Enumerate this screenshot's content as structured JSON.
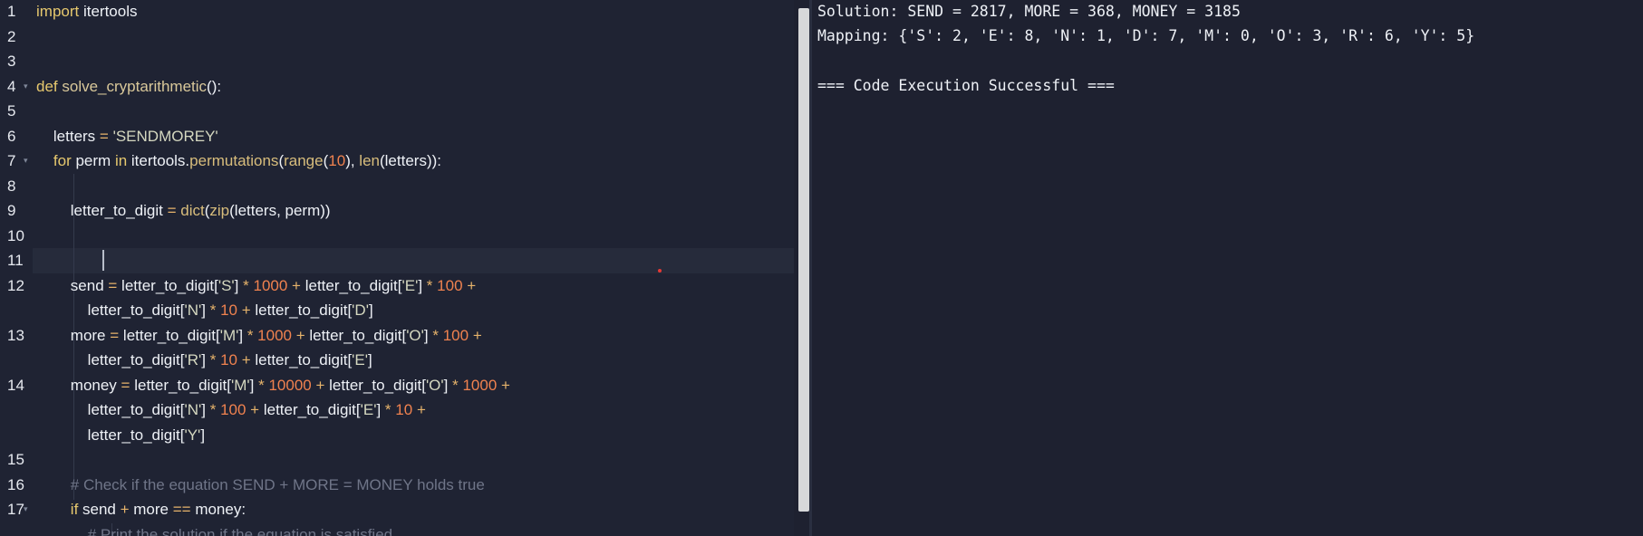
{
  "editor": {
    "lines": [
      {
        "n": "1",
        "fold": false,
        "tokens": [
          {
            "t": "kw",
            "v": "import"
          },
          {
            "t": "txt",
            "v": " itertools"
          }
        ]
      },
      {
        "n": "2",
        "fold": false,
        "tokens": []
      },
      {
        "n": "3",
        "fold": false,
        "tokens": []
      },
      {
        "n": "4",
        "fold": true,
        "tokens": [
          {
            "t": "kw",
            "v": "def"
          },
          {
            "t": "txt",
            "v": " "
          },
          {
            "t": "fn",
            "v": "solve_cryptarithmetic"
          },
          {
            "t": "txt",
            "v": "():"
          }
        ]
      },
      {
        "n": "5",
        "fold": false,
        "tokens": []
      },
      {
        "n": "6",
        "fold": false,
        "tokens": [
          {
            "t": "txt",
            "v": "    letters "
          },
          {
            "t": "op",
            "v": "="
          },
          {
            "t": "txt",
            "v": " "
          },
          {
            "t": "str",
            "v": "'SENDMOREY'"
          }
        ]
      },
      {
        "n": "7",
        "fold": true,
        "tokens": [
          {
            "t": "txt",
            "v": "    "
          },
          {
            "t": "kw",
            "v": "for"
          },
          {
            "t": "txt",
            "v": " perm "
          },
          {
            "t": "kw",
            "v": "in"
          },
          {
            "t": "txt",
            "v": " itertools."
          },
          {
            "t": "bi",
            "v": "permutations"
          },
          {
            "t": "txt",
            "v": "("
          },
          {
            "t": "bi",
            "v": "range"
          },
          {
            "t": "txt",
            "v": "("
          },
          {
            "t": "num",
            "v": "10"
          },
          {
            "t": "txt",
            "v": "), "
          },
          {
            "t": "bi",
            "v": "len"
          },
          {
            "t": "txt",
            "v": "(letters)):"
          }
        ]
      },
      {
        "n": "8",
        "fold": false,
        "tokens": []
      },
      {
        "n": "9",
        "fold": false,
        "tokens": [
          {
            "t": "txt",
            "v": "        letter_to_digit "
          },
          {
            "t": "op",
            "v": "="
          },
          {
            "t": "txt",
            "v": " "
          },
          {
            "t": "bi",
            "v": "dict"
          },
          {
            "t": "txt",
            "v": "("
          },
          {
            "t": "bi",
            "v": "zip"
          },
          {
            "t": "txt",
            "v": "(letters, perm))"
          }
        ]
      },
      {
        "n": "10",
        "fold": false,
        "tokens": []
      },
      {
        "n": "11",
        "fold": false,
        "tokens": []
      },
      {
        "n": "12",
        "fold": false,
        "tokens": [
          {
            "t": "txt",
            "v": "        send "
          },
          {
            "t": "op",
            "v": "="
          },
          {
            "t": "txt",
            "v": " letter_to_digit["
          },
          {
            "t": "str",
            "v": "'S'"
          },
          {
            "t": "txt",
            "v": "] "
          },
          {
            "t": "op",
            "v": "*"
          },
          {
            "t": "txt",
            "v": " "
          },
          {
            "t": "num",
            "v": "1000"
          },
          {
            "t": "txt",
            "v": " "
          },
          {
            "t": "op",
            "v": "+"
          },
          {
            "t": "txt",
            "v": " letter_to_digit["
          },
          {
            "t": "str",
            "v": "'E'"
          },
          {
            "t": "txt",
            "v": "] "
          },
          {
            "t": "op",
            "v": "*"
          },
          {
            "t": "txt",
            "v": " "
          },
          {
            "t": "num",
            "v": "100"
          },
          {
            "t": "txt",
            "v": " "
          },
          {
            "t": "op",
            "v": "+"
          }
        ]
      },
      {
        "n": "",
        "fold": false,
        "tokens": [
          {
            "t": "txt",
            "v": "            letter_to_digit["
          },
          {
            "t": "str",
            "v": "'N'"
          },
          {
            "t": "txt",
            "v": "] "
          },
          {
            "t": "op",
            "v": "*"
          },
          {
            "t": "txt",
            "v": " "
          },
          {
            "t": "num",
            "v": "10"
          },
          {
            "t": "txt",
            "v": " "
          },
          {
            "t": "op",
            "v": "+"
          },
          {
            "t": "txt",
            "v": " letter_to_digit["
          },
          {
            "t": "str",
            "v": "'D'"
          },
          {
            "t": "txt",
            "v": "]"
          }
        ]
      },
      {
        "n": "13",
        "fold": false,
        "tokens": [
          {
            "t": "txt",
            "v": "        more "
          },
          {
            "t": "op",
            "v": "="
          },
          {
            "t": "txt",
            "v": " letter_to_digit["
          },
          {
            "t": "str",
            "v": "'M'"
          },
          {
            "t": "txt",
            "v": "] "
          },
          {
            "t": "op",
            "v": "*"
          },
          {
            "t": "txt",
            "v": " "
          },
          {
            "t": "num",
            "v": "1000"
          },
          {
            "t": "txt",
            "v": " "
          },
          {
            "t": "op",
            "v": "+"
          },
          {
            "t": "txt",
            "v": " letter_to_digit["
          },
          {
            "t": "str",
            "v": "'O'"
          },
          {
            "t": "txt",
            "v": "] "
          },
          {
            "t": "op",
            "v": "*"
          },
          {
            "t": "txt",
            "v": " "
          },
          {
            "t": "num",
            "v": "100"
          },
          {
            "t": "txt",
            "v": " "
          },
          {
            "t": "op",
            "v": "+"
          }
        ]
      },
      {
        "n": "",
        "fold": false,
        "tokens": [
          {
            "t": "txt",
            "v": "            letter_to_digit["
          },
          {
            "t": "str",
            "v": "'R'"
          },
          {
            "t": "txt",
            "v": "] "
          },
          {
            "t": "op",
            "v": "*"
          },
          {
            "t": "txt",
            "v": " "
          },
          {
            "t": "num",
            "v": "10"
          },
          {
            "t": "txt",
            "v": " "
          },
          {
            "t": "op",
            "v": "+"
          },
          {
            "t": "txt",
            "v": " letter_to_digit["
          },
          {
            "t": "str",
            "v": "'E'"
          },
          {
            "t": "txt",
            "v": "]"
          }
        ]
      },
      {
        "n": "14",
        "fold": false,
        "tokens": [
          {
            "t": "txt",
            "v": "        money "
          },
          {
            "t": "op",
            "v": "="
          },
          {
            "t": "txt",
            "v": " letter_to_digit["
          },
          {
            "t": "str",
            "v": "'M'"
          },
          {
            "t": "txt",
            "v": "] "
          },
          {
            "t": "op",
            "v": "*"
          },
          {
            "t": "txt",
            "v": " "
          },
          {
            "t": "num",
            "v": "10000"
          },
          {
            "t": "txt",
            "v": " "
          },
          {
            "t": "op",
            "v": "+"
          },
          {
            "t": "txt",
            "v": " letter_to_digit["
          },
          {
            "t": "str",
            "v": "'O'"
          },
          {
            "t": "txt",
            "v": "] "
          },
          {
            "t": "op",
            "v": "*"
          },
          {
            "t": "txt",
            "v": " "
          },
          {
            "t": "num",
            "v": "1000"
          },
          {
            "t": "txt",
            "v": " "
          },
          {
            "t": "op",
            "v": "+"
          }
        ]
      },
      {
        "n": "",
        "fold": false,
        "tokens": [
          {
            "t": "txt",
            "v": "            letter_to_digit["
          },
          {
            "t": "str",
            "v": "'N'"
          },
          {
            "t": "txt",
            "v": "] "
          },
          {
            "t": "op",
            "v": "*"
          },
          {
            "t": "txt",
            "v": " "
          },
          {
            "t": "num",
            "v": "100"
          },
          {
            "t": "txt",
            "v": " "
          },
          {
            "t": "op",
            "v": "+"
          },
          {
            "t": "txt",
            "v": " letter_to_digit["
          },
          {
            "t": "str",
            "v": "'E'"
          },
          {
            "t": "txt",
            "v": "] "
          },
          {
            "t": "op",
            "v": "*"
          },
          {
            "t": "txt",
            "v": " "
          },
          {
            "t": "num",
            "v": "10"
          },
          {
            "t": "txt",
            "v": " "
          },
          {
            "t": "op",
            "v": "+"
          }
        ]
      },
      {
        "n": "",
        "fold": false,
        "tokens": [
          {
            "t": "txt",
            "v": "            letter_to_digit["
          },
          {
            "t": "str",
            "v": "'Y'"
          },
          {
            "t": "txt",
            "v": "]"
          }
        ]
      },
      {
        "n": "15",
        "fold": false,
        "tokens": []
      },
      {
        "n": "16",
        "fold": false,
        "tokens": [
          {
            "t": "txt",
            "v": "        "
          },
          {
            "t": "cm",
            "v": "# Check if the equation SEND + MORE = MONEY holds true"
          }
        ]
      },
      {
        "n": "17",
        "fold": true,
        "tokens": [
          {
            "t": "txt",
            "v": "        "
          },
          {
            "t": "kw",
            "v": "if"
          },
          {
            "t": "txt",
            "v": " send "
          },
          {
            "t": "op",
            "v": "+"
          },
          {
            "t": "txt",
            "v": " more "
          },
          {
            "t": "op",
            "v": "=="
          },
          {
            "t": "txt",
            "v": " money:"
          }
        ]
      },
      {
        "n": "",
        "fold": false,
        "tokens": [
          {
            "t": "txt",
            "v": "            "
          },
          {
            "t": "cm",
            "v": "# Print the solution if the equation is satisfied"
          }
        ]
      }
    ]
  },
  "output": {
    "solution": "Solution: SEND = 2817, MORE = 368, MONEY = 3185",
    "mapping": "Mapping: {'S': 2, 'E': 8, 'N': 1, 'D': 7, 'M': 0, 'O': 3, 'R': 6, 'Y': 5}",
    "status": "=== Code Execution Successful ==="
  }
}
